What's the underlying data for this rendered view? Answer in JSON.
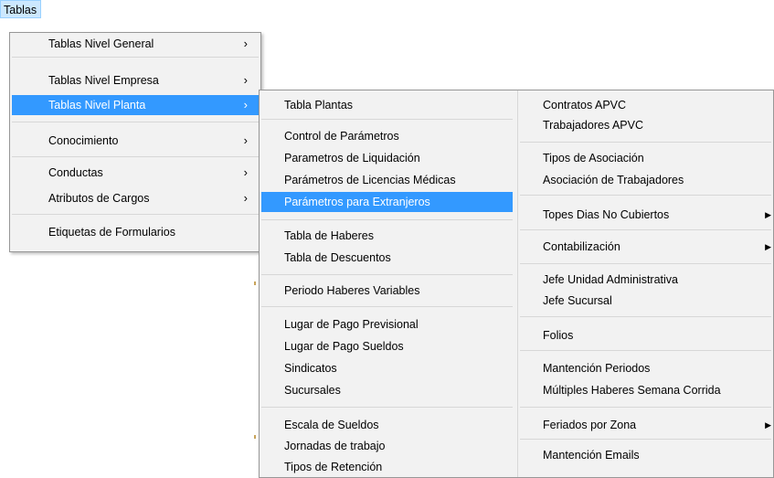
{
  "menubar": {
    "tablas": "Tablas"
  },
  "menu1": {
    "items": [
      {
        "label": "Tablas Nivel General",
        "arrow": "›"
      },
      {
        "label": "Tablas Nivel Empresa",
        "arrow": "›"
      },
      {
        "label": "Tablas Nivel Planta",
        "arrow": "›"
      },
      {
        "label": "Conocimiento",
        "arrow": "›"
      },
      {
        "label": "Conductas",
        "arrow": "›"
      },
      {
        "label": "Atributos de Cargos",
        "arrow": "›"
      },
      {
        "label": "Etiquetas de Formularios"
      }
    ]
  },
  "menu2": {
    "col1": [
      "Tabla Plantas",
      "Control de Parámetros",
      "Parametros de Liquidación",
      "Parámetros de Licencias Médicas",
      "Parámetros para Extranjeros",
      "Tabla de Haberes",
      "Tabla de Descuentos",
      "Periodo Haberes Variables",
      "Lugar de Pago Previsional",
      "Lugar de Pago Sueldos",
      "Sindicatos",
      "Sucursales",
      "Escala de Sueldos",
      "Jornadas de trabajo",
      "Tipos de Retención"
    ],
    "col2": [
      "Contratos APVC",
      "Trabajadores APVC",
      "Tipos de Asociación",
      "Asociación de Trabajadores",
      "Topes Dias No Cubiertos",
      "Contabilización",
      "Jefe Unidad Administrativa",
      "Jefe Sucursal",
      "Folios",
      "Mantención Periodos",
      "Múltiples Haberes Semana Corrida",
      "Feriados por Zona",
      "Mantención Emails"
    ],
    "submenu_triangle": "▶"
  }
}
